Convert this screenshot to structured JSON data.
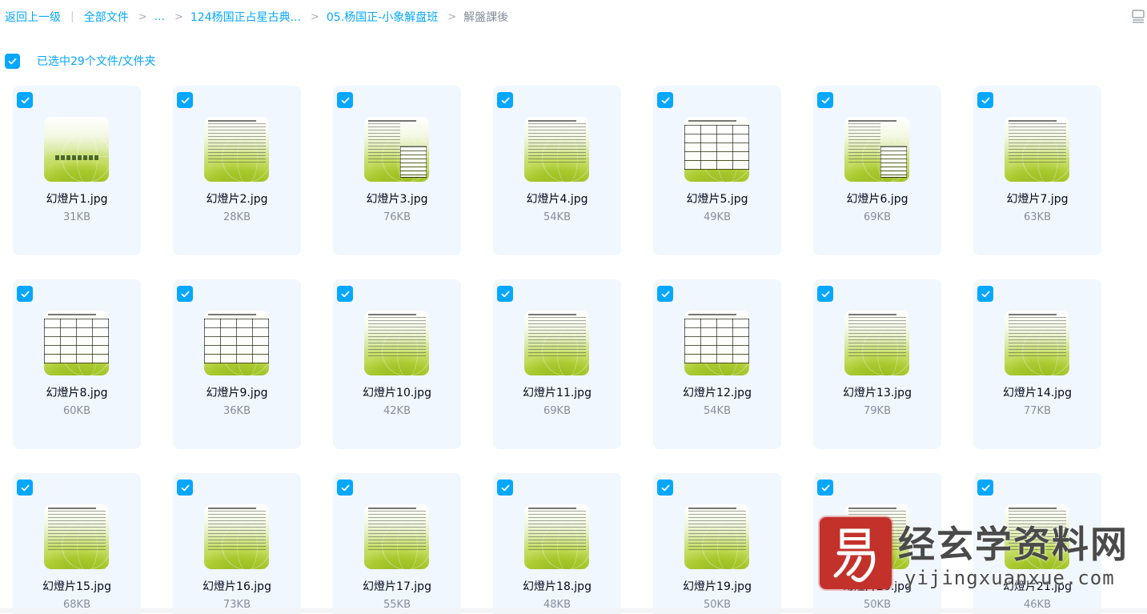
{
  "breadcrumb": {
    "back": "返回上一级",
    "all_files": "全部文件",
    "ellipsis": "...",
    "folder1": "124杨国正占星古典...",
    "folder2": "05.杨国正-小象解盘班",
    "current": "解盤課後"
  },
  "selection": {
    "text": "已选中29个文件/文件夹"
  },
  "files": [
    {
      "name": "幻燈片1.jpg",
      "size": "31KB",
      "thumb": "cover"
    },
    {
      "name": "幻燈片2.jpg",
      "size": "28KB",
      "thumb": "text"
    },
    {
      "name": "幻燈片3.jpg",
      "size": "76KB",
      "thumb": "side-table"
    },
    {
      "name": "幻燈片4.jpg",
      "size": "54KB",
      "thumb": "text"
    },
    {
      "name": "幻燈片5.jpg",
      "size": "49KB",
      "thumb": "table"
    },
    {
      "name": "幻燈片6.jpg",
      "size": "69KB",
      "thumb": "side-table"
    },
    {
      "name": "幻燈片7.jpg",
      "size": "63KB",
      "thumb": "text"
    },
    {
      "name": "幻燈片8.jpg",
      "size": "60KB",
      "thumb": "table"
    },
    {
      "name": "幻燈片9.jpg",
      "size": "36KB",
      "thumb": "table"
    },
    {
      "name": "幻燈片10.jpg",
      "size": "42KB",
      "thumb": "text"
    },
    {
      "name": "幻燈片11.jpg",
      "size": "69KB",
      "thumb": "text"
    },
    {
      "name": "幻燈片12.jpg",
      "size": "54KB",
      "thumb": "table"
    },
    {
      "name": "幻燈片13.jpg",
      "size": "79KB",
      "thumb": "text"
    },
    {
      "name": "幻燈片14.jpg",
      "size": "77KB",
      "thumb": "text"
    },
    {
      "name": "幻燈片15.jpg",
      "size": "68KB",
      "thumb": "text"
    },
    {
      "name": "幻燈片16.jpg",
      "size": "73KB",
      "thumb": "text"
    },
    {
      "name": "幻燈片17.jpg",
      "size": "55KB",
      "thumb": "text"
    },
    {
      "name": "幻燈片18.jpg",
      "size": "48KB",
      "thumb": "text"
    },
    {
      "name": "幻燈片19.jpg",
      "size": "50KB",
      "thumb": "text"
    },
    {
      "name": "幻燈片20.jpg",
      "size": "50KB",
      "thumb": "text"
    },
    {
      "name": "幻燈片21.jpg",
      "size": "46KB",
      "thumb": "text"
    }
  ],
  "watermark": {
    "title": "经玄学资料网",
    "url": "yijingxuanxue.com"
  },
  "colors": {
    "accent": "#06a7ff",
    "card_bg": "#f1f7ff",
    "muted": "#878c9c",
    "text": "#03081a"
  }
}
